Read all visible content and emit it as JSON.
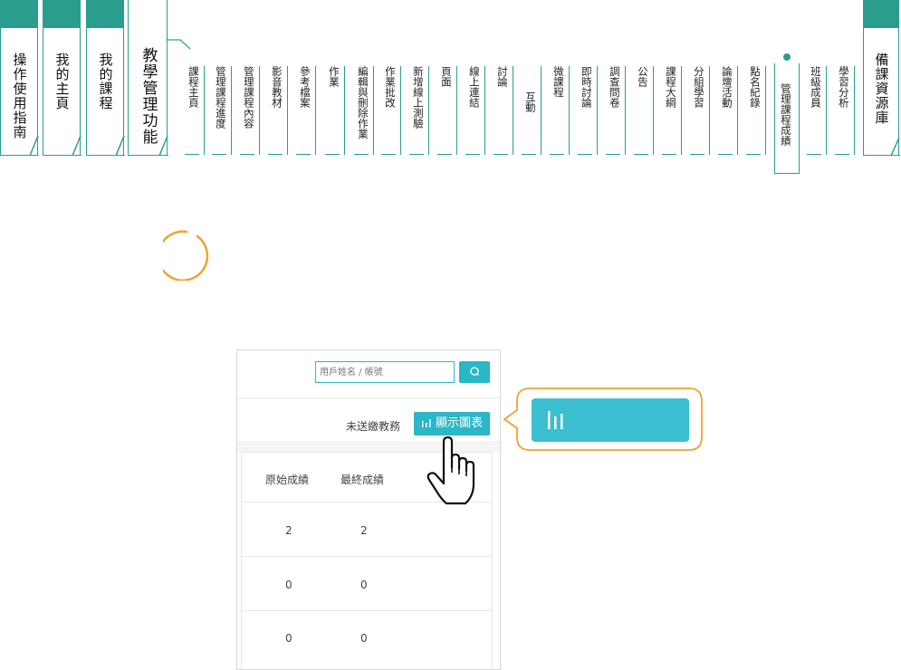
{
  "main_tabs": [
    {
      "label": "操作使用指南"
    },
    {
      "label": "我的主頁"
    },
    {
      "label": "我的課程"
    },
    {
      "label": "教學管理功能"
    }
  ],
  "right_tab": {
    "label": "備課資源庫"
  },
  "sub_tabs": [
    {
      "label": "課程主頁"
    },
    {
      "label": "管理課程進度"
    },
    {
      "label": "管理課程內容"
    },
    {
      "label": "影音教材"
    },
    {
      "label": "參考檔案"
    },
    {
      "label": "作業"
    },
    {
      "label": "編輯與刪除作業"
    },
    {
      "label": "作業批改"
    },
    {
      "label": "新增線上測驗"
    },
    {
      "label": "頁面"
    },
    {
      "label": "線上連結"
    },
    {
      "label": "討論"
    },
    {
      "label": "互動"
    },
    {
      "label": "微課程"
    },
    {
      "label": "即時討論"
    },
    {
      "label": "調查問卷"
    },
    {
      "label": "公告"
    },
    {
      "label": "課程大綱"
    },
    {
      "label": "分組學習"
    },
    {
      "label": "論壇活動"
    },
    {
      "label": "點名紀錄"
    }
  ],
  "active_sub_tab": {
    "label": "管理課程成績"
  },
  "sub_tabs_after": [
    {
      "label": "班級成員"
    },
    {
      "label": "學習分析"
    }
  ],
  "panel": {
    "search_placeholder": "用戶姓名 / 帳號",
    "unsent_label": "未送繳教務",
    "chart_button_label": "顯示圖表",
    "chart_icon": "bar-chart-icon",
    "search_icon": "search-icon",
    "table": {
      "headers": [
        "原始成績",
        "最終成績"
      ],
      "rows": [
        [
          "2",
          "2"
        ],
        [
          "0",
          "0"
        ],
        [
          "0",
          "0"
        ]
      ]
    }
  },
  "colors": {
    "accent": "#2a9d8f",
    "button": "#2ab7c7",
    "highlight": "#f0a22e"
  }
}
